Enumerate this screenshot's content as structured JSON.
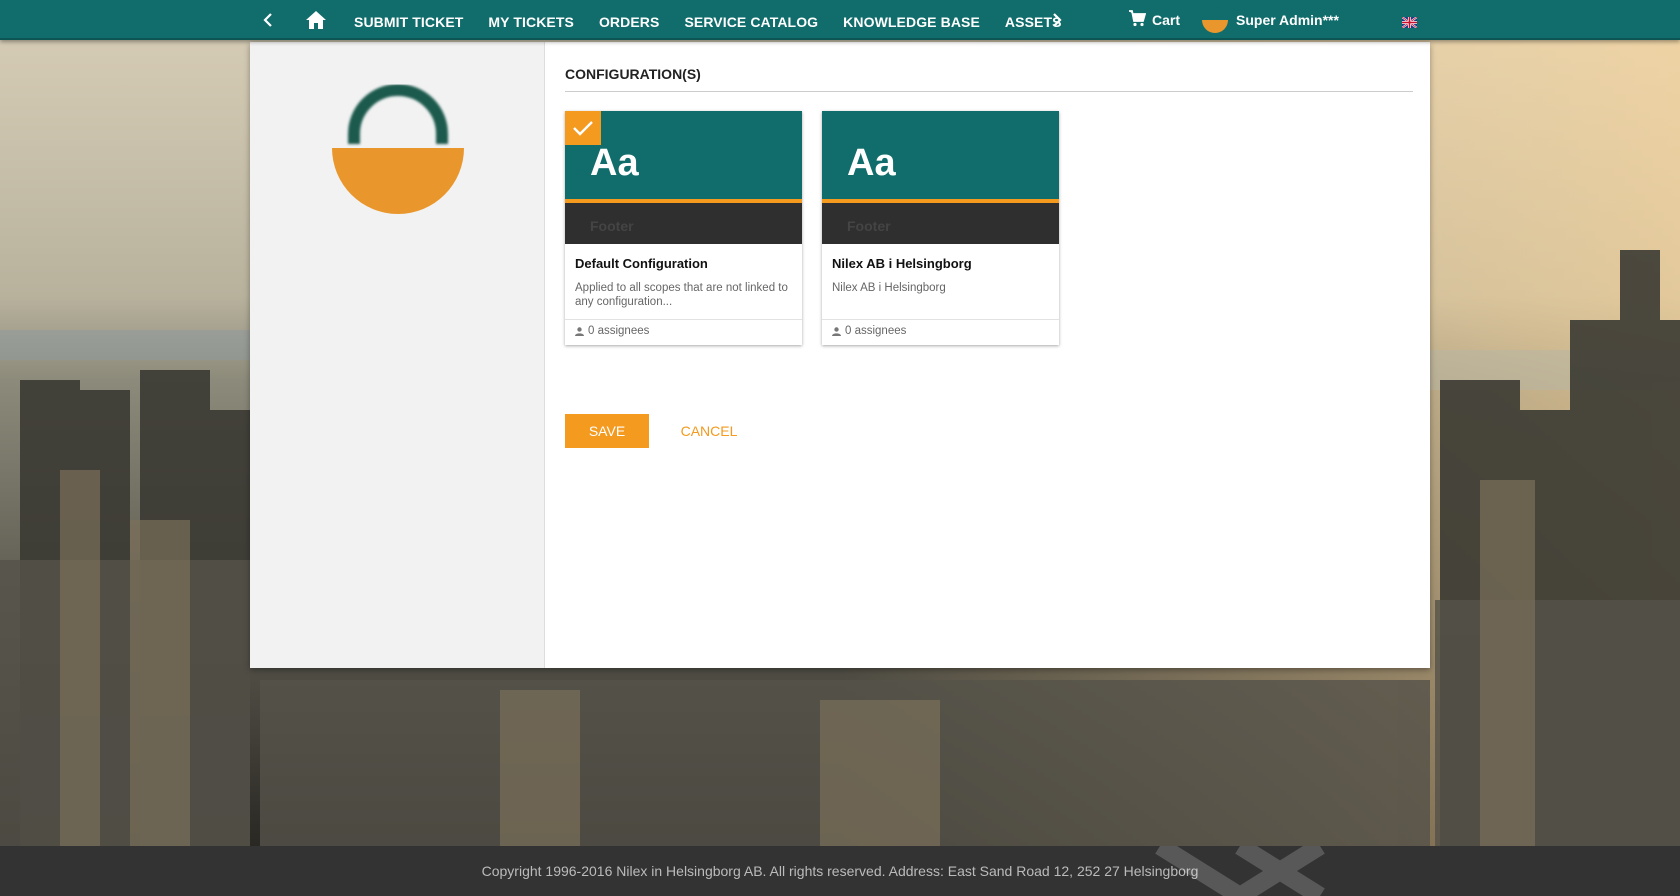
{
  "topbar": {
    "nav_items": [
      {
        "label": "SUBMIT TICKET"
      },
      {
        "label": "MY TICKETS"
      },
      {
        "label": "ORDERS"
      },
      {
        "label": "SERVICE CATALOG"
      },
      {
        "label": "KNOWLEDGE BASE"
      },
      {
        "label": "ASSETS"
      }
    ],
    "cart_label": "Cart",
    "user_name": "Super Admin***",
    "icons": [
      "chevron-left-icon",
      "home-icon",
      "chevron-right-icon",
      "cart-icon",
      "uk-flag-icon"
    ]
  },
  "main": {
    "section_title": "CONFIGURATION(S)",
    "cards": [
      {
        "preview_text": "Aa",
        "footer_text": "Footer",
        "name": "Default Configuration",
        "description": "Applied to all scopes that are not linked to any configuration...",
        "assignees": "0 assignees",
        "selected": true
      },
      {
        "preview_text": "Aa",
        "footer_text": "Footer",
        "name": "Nilex AB i Helsingborg",
        "description": "Nilex AB i Helsingborg",
        "assignees": "0 assignees",
        "selected": false
      }
    ],
    "save_label": "SAVE",
    "cancel_label": "CANCEL"
  },
  "footer": {
    "text": "Copyright 1996-2016 Nilex in Helsingborg AB. All rights reserved. Address: East Sand Road 12, 252 27 Helsingborg"
  },
  "colors": {
    "primary": "#116c6c",
    "accent": "#f39a1f",
    "footer_bg": "#333333"
  }
}
